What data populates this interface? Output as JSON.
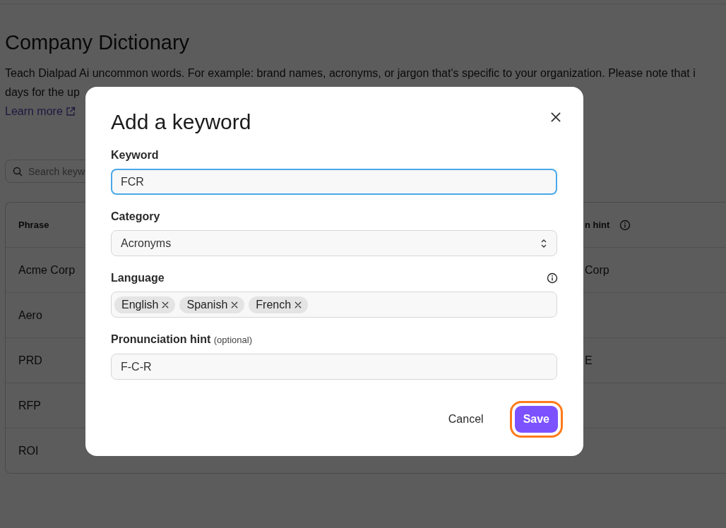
{
  "page": {
    "title": "Company Dictionary",
    "description_lines": [
      "Teach Dialpad Ai uncommon words. For example: brand names, acronyms, or jargon that's specific to your organization. Please note that i",
      "days for the up"
    ],
    "learn_more": "Learn more",
    "search": {
      "placeholder": "Search keyw"
    }
  },
  "table": {
    "columns": [
      "Phrase",
      "n hint"
    ],
    "rows": [
      {
        "phrase": "Acme Corp",
        "hint": "Corp"
      },
      {
        "phrase": "Aero"
      },
      {
        "phrase": "PRD",
        "hint": "E"
      },
      {
        "phrase": "RFP"
      },
      {
        "phrase": "ROI"
      }
    ]
  },
  "dialog": {
    "title": "Add a keyword",
    "fields": [
      {
        "kind": "text",
        "label": "Keyword",
        "value": "FCR",
        "focused": true
      },
      {
        "kind": "select",
        "label": "Category",
        "value": "Acronyms"
      },
      {
        "kind": "tags",
        "label": "Language",
        "info": true,
        "tags": [
          "English",
          "Spanish",
          "French"
        ]
      },
      {
        "kind": "text",
        "label": "Pronunciation hint",
        "note": "(optional)",
        "value": "F-C-R",
        "focused": false
      }
    ],
    "buttons": [
      {
        "kind": "secondary",
        "label": "Cancel",
        "highlighted": false
      },
      {
        "kind": "primary",
        "label": "Save",
        "highlighted": true
      }
    ]
  }
}
